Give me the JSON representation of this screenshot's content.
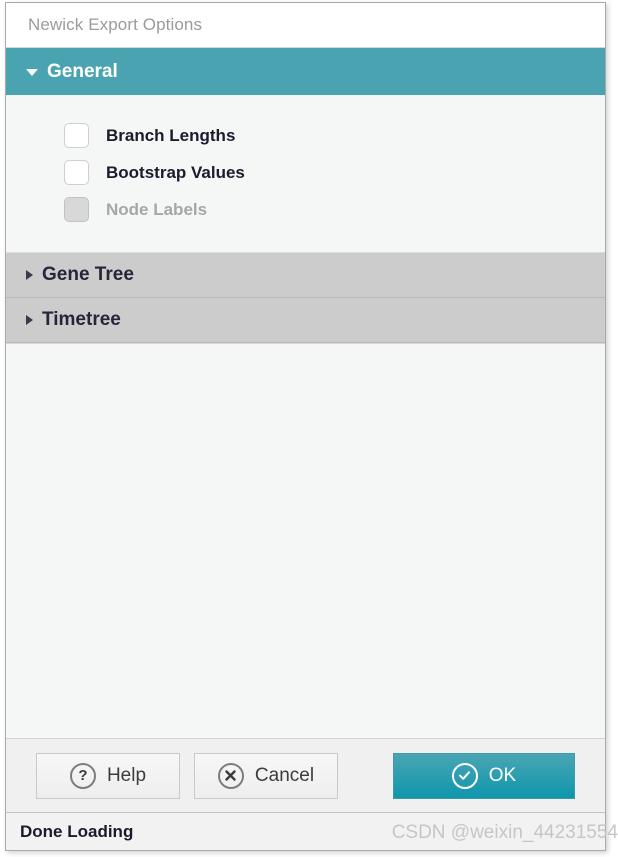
{
  "window": {
    "title": "Newick Export Options"
  },
  "sections": [
    {
      "id": "general",
      "label": "General",
      "expanded": true,
      "triangle_icon": "triangle-down-icon",
      "options": [
        {
          "label": "Branch Lengths",
          "checked": false,
          "disabled": false
        },
        {
          "label": "Bootstrap Values",
          "checked": false,
          "disabled": false
        },
        {
          "label": "Node Labels",
          "checked": false,
          "disabled": true
        }
      ]
    },
    {
      "id": "gene-tree",
      "label": "Gene Tree",
      "expanded": false,
      "triangle_icon": "triangle-right-icon"
    },
    {
      "id": "timetree",
      "label": "Timetree",
      "expanded": false,
      "triangle_icon": "triangle-right-icon"
    }
  ],
  "footer": {
    "help_label": "Help",
    "help_icon": "question-mark-circle-icon",
    "cancel_label": "Cancel",
    "cancel_icon": "x-circle-icon",
    "ok_label": "OK",
    "ok_icon": "check-circle-icon"
  },
  "statusbar": {
    "text": "Done Loading"
  },
  "watermark": {
    "text": "CSDN @weixin_44231554"
  },
  "colors": {
    "accent_teal": "#4aa3b1",
    "ok_button_top": "#49a6b4",
    "ok_button_bottom": "#0f96ad",
    "collapsed_header": "#cccccc",
    "panel_background": "#f5f7f7",
    "title_text": "#9b9b9b",
    "label_text": "#1b1b2c",
    "disabled_text": "#a6a6a6"
  }
}
